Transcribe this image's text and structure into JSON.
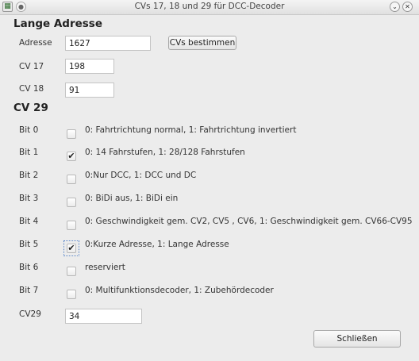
{
  "window": {
    "title": "CVs 17, 18 und 29 für DCC-Decoder",
    "app_icon": "app-icon",
    "menu_icon": "window-menu-icon",
    "minimize_glyph": "⌄",
    "close_glyph": "✕"
  },
  "long_address": {
    "heading": "Lange Adresse",
    "address_label": "Adresse",
    "address_value": "1627",
    "calc_button": "CVs bestimmen",
    "cv17_label": "CV 17",
    "cv17_value": "198",
    "cv18_label": "CV 18",
    "cv18_value": "91"
  },
  "cv29": {
    "heading": "CV 29",
    "bits": [
      {
        "label": "Bit 0",
        "checked": false,
        "text": "0: Fahrtrichtung normal, 1: Fahrtrichtung invertiert"
      },
      {
        "label": "Bit 1",
        "checked": true,
        "text": "0: 14 Fahrstufen, 1: 28/128 Fahrstufen"
      },
      {
        "label": "Bit 2",
        "checked": false,
        "text": "0:Nur DCC, 1: DCC und DC"
      },
      {
        "label": "Bit 3",
        "checked": false,
        "text": "0: BiDi aus, 1: BiDi ein"
      },
      {
        "label": "Bit 4",
        "checked": false,
        "text": "0: Geschwindigkeit gem. CV2, CV5 , CV6, 1: Geschwindigkeit gem. CV66-CV95"
      },
      {
        "label": "Bit 5",
        "checked": true,
        "focused": true,
        "text": "0:Kurze Adresse, 1: Lange Adresse"
      },
      {
        "label": "Bit 6",
        "checked": false,
        "text": "reserviert"
      },
      {
        "label": "Bit 7",
        "checked": false,
        "text": "0: Multifunktionsdecoder, 1: Zubehördecoder"
      }
    ],
    "value_label": "CV29",
    "value": "34"
  },
  "close_button": "Schließen",
  "colors": {
    "focus": "#5a86c8",
    "background": "#ececec"
  }
}
